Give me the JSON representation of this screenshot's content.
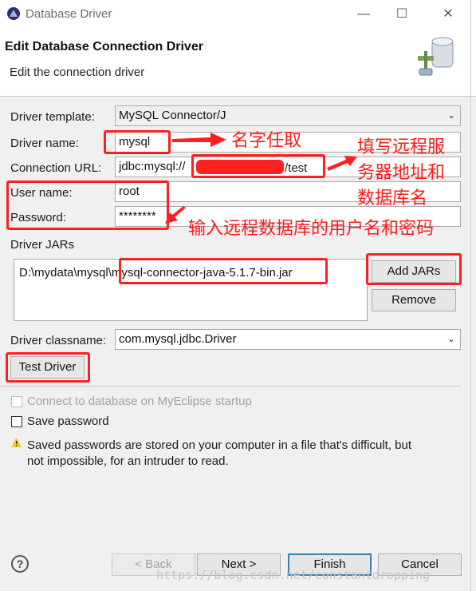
{
  "window": {
    "title": "Database Driver",
    "minimize_glyph": "—",
    "maximize_glyph": "☐",
    "close_glyph": "✕"
  },
  "header": {
    "title": "Edit Database Connection Driver",
    "description": "Edit the connection driver"
  },
  "form": {
    "driver_template": {
      "label": "Driver template:",
      "value": "MySQL Connector/J"
    },
    "driver_name": {
      "label": "Driver name:",
      "value": "mysql"
    },
    "connection_url": {
      "label": "Connection URL:",
      "prefix": "jdbc:mysql://",
      "suffix": "/test"
    },
    "user_name": {
      "label": "User name:",
      "value": "root"
    },
    "password": {
      "label": "Password:",
      "value": "********"
    },
    "driver_jars": {
      "label": "Driver JARs",
      "items": [
        "D:\\mydata\\mysql\\mysql-connector-java-5.1.7-bin.jar"
      ],
      "add_button": "Add JARs",
      "remove_button": "Remove"
    },
    "driver_classname": {
      "label": "Driver classname:",
      "value": "com.mysql.jdbc.Driver"
    },
    "test_button": "Test Driver"
  },
  "options": {
    "connect_on_startup": {
      "label": "Connect to database on MyEclipse startup",
      "checked": false,
      "enabled": false
    },
    "save_password": {
      "label": "Save password",
      "checked": false
    },
    "warning_text_line1": "Saved passwords are stored on your computer in a file that's difficult, but",
    "warning_text_line2": "not impossible, for an intruder to read."
  },
  "footer": {
    "help_glyph": "?",
    "back": "< Back",
    "next": "Next >",
    "finish": "Finish",
    "cancel": "Cancel"
  },
  "annotations": {
    "name_note": "名字任取",
    "url_note_line1": "填写远程服",
    "url_note_line2": "务器地址和",
    "url_note_line3": "数据库名",
    "credentials_note": "输入远程数据库的用户名和密码"
  },
  "watermark": "https://blog.csdn.net/constantdropping",
  "colors": {
    "annotation": "#ff1f1f",
    "default_button_border": "#3c7fb1",
    "dialog_body": "#f0f0f0"
  }
}
